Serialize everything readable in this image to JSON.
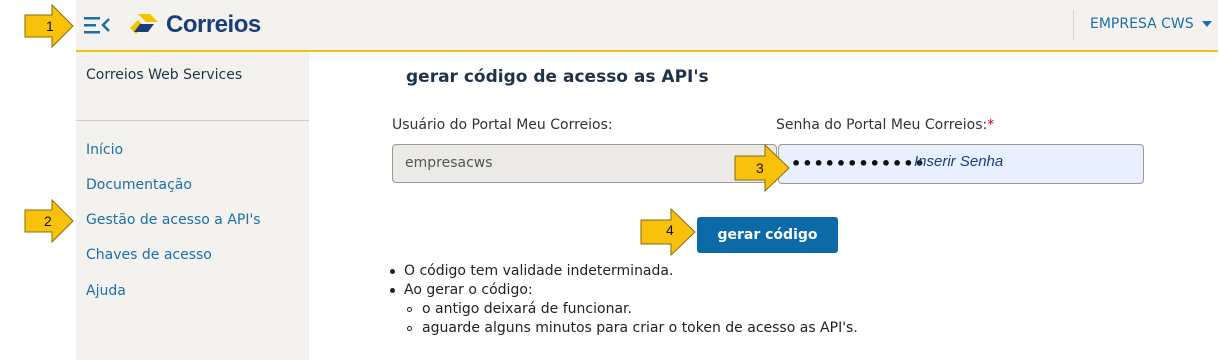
{
  "header": {
    "brand": "Correios",
    "company": "EMPRESA CWS"
  },
  "sidebar": {
    "title": "Correios Web Services",
    "items": [
      {
        "label": "Início"
      },
      {
        "label": "Documentação"
      },
      {
        "label": "Gestão de acesso a API's"
      },
      {
        "label": "Chaves de acesso"
      },
      {
        "label": "Ajuda"
      }
    ]
  },
  "main": {
    "title": "gerar código de acesso as API's",
    "user_label": "Usuário do Portal Meu Correios:",
    "user_value": "empresacws",
    "password_label": "Senha do Portal Meu Correios:",
    "required_mark": "*",
    "password_masked": "••••••••••••",
    "password_hint": "Inserir Senha",
    "button_label": "gerar código",
    "notes": {
      "validity": "O código tem validade indeterminada.",
      "on_generate": "Ao gerar o código:",
      "sub1": "o antigo deixará de funcionar.",
      "sub2": "aguarde alguns minutos para criar o token de acesso as API's."
    }
  },
  "callouts": {
    "one": "1",
    "two": "2",
    "three": "3",
    "four": "4"
  },
  "colors": {
    "accent_blue": "#0d6aa8",
    "link_blue": "#1d6fa5",
    "brand_navy": "#1a3d7c",
    "brand_yellow": "#f5c400",
    "callout_yellow": "#f7c10c"
  }
}
